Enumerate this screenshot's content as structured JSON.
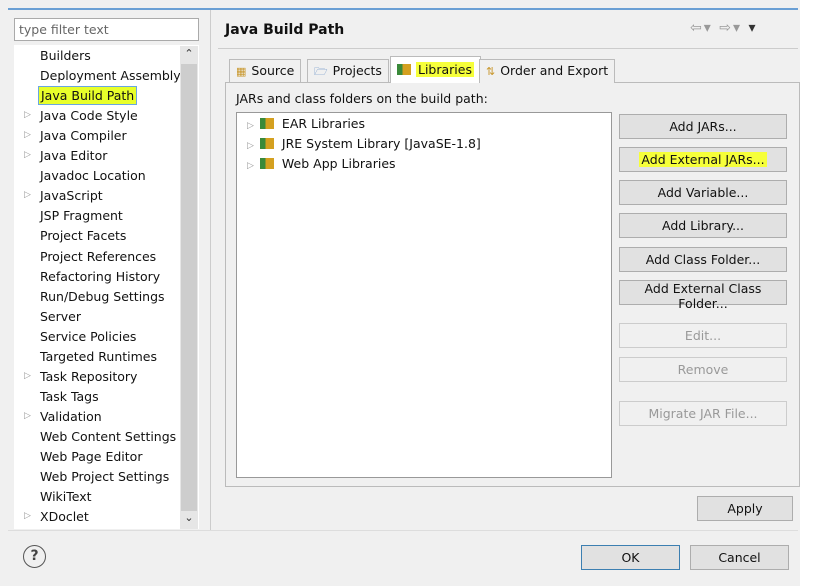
{
  "filter": {
    "placeholder": "type filter text"
  },
  "tree": {
    "items": [
      {
        "label": "Builders",
        "expandable": false
      },
      {
        "label": "Deployment Assembly",
        "expandable": false
      },
      {
        "label": "Java Build Path",
        "expandable": false,
        "selected": true
      },
      {
        "label": "Java Code Style",
        "expandable": true
      },
      {
        "label": "Java Compiler",
        "expandable": true
      },
      {
        "label": "Java Editor",
        "expandable": true
      },
      {
        "label": "Javadoc Location",
        "expandable": false
      },
      {
        "label": "JavaScript",
        "expandable": true
      },
      {
        "label": "JSP Fragment",
        "expandable": false
      },
      {
        "label": "Project Facets",
        "expandable": false
      },
      {
        "label": "Project References",
        "expandable": false
      },
      {
        "label": "Refactoring History",
        "expandable": false
      },
      {
        "label": "Run/Debug Settings",
        "expandable": false
      },
      {
        "label": "Server",
        "expandable": false
      },
      {
        "label": "Service Policies",
        "expandable": false
      },
      {
        "label": "Targeted Runtimes",
        "expandable": false
      },
      {
        "label": "Task Repository",
        "expandable": true
      },
      {
        "label": "Task Tags",
        "expandable": false
      },
      {
        "label": "Validation",
        "expandable": true
      },
      {
        "label": "Web Content Settings",
        "expandable": false
      },
      {
        "label": "Web Page Editor",
        "expandable": false
      },
      {
        "label": "Web Project Settings",
        "expandable": false
      },
      {
        "label": "WikiText",
        "expandable": false
      },
      {
        "label": "XDoclet",
        "expandable": true
      }
    ]
  },
  "header": {
    "title": "Java Build Path"
  },
  "tabs": [
    {
      "label": "Source",
      "active": false
    },
    {
      "label": "Projects",
      "active": false
    },
    {
      "label": "Libraries",
      "active": true
    },
    {
      "label": "Order and Export",
      "active": false
    }
  ],
  "libraries": {
    "label": "JARs and class folders on the build path:",
    "items": [
      "EAR Libraries",
      "JRE System Library [JavaSE-1.8]",
      "Web App Libraries"
    ]
  },
  "buttons": [
    {
      "label": "Add JARs...",
      "enabled": true
    },
    {
      "label": "Add External JARs...",
      "enabled": true,
      "highlight": true
    },
    {
      "label": "Add Variable...",
      "enabled": true
    },
    {
      "label": "Add Library...",
      "enabled": true
    },
    {
      "label": "Add Class Folder...",
      "enabled": true
    },
    {
      "label": "Add External Class Folder...",
      "enabled": true
    },
    {
      "label": "Edit...",
      "enabled": false
    },
    {
      "label": "Remove",
      "enabled": false
    },
    {
      "label": "Migrate JAR File...",
      "enabled": false
    }
  ],
  "footer": {
    "apply": "Apply",
    "ok": "OK",
    "cancel": "Cancel",
    "help": "?"
  }
}
